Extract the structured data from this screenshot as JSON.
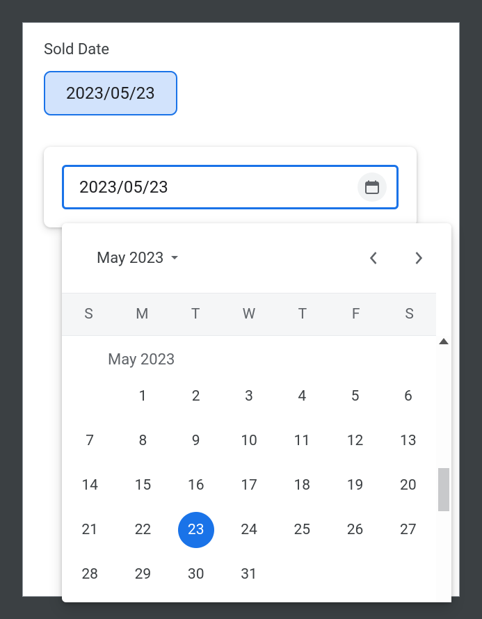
{
  "field": {
    "label": "Sold Date"
  },
  "chip": {
    "value": "2023/05/23"
  },
  "input": {
    "value": "2023/05/23"
  },
  "calendar": {
    "headerMonth": "May 2023",
    "weekdays": [
      "S",
      "M",
      "T",
      "W",
      "T",
      "F",
      "S"
    ],
    "monthTitle": "May 2023",
    "startBlank": 1,
    "days": 31,
    "selected": 23
  }
}
